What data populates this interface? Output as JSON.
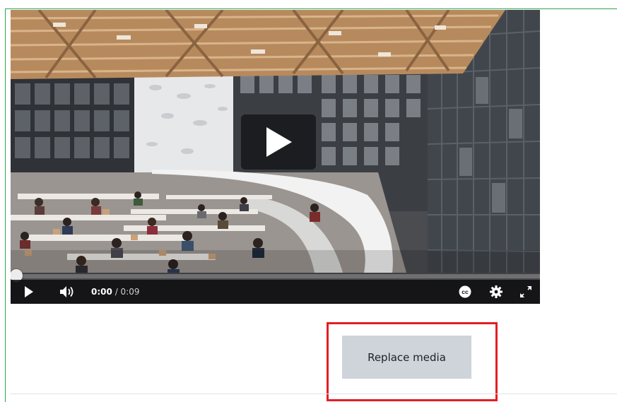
{
  "player": {
    "current_time": "0:00",
    "duration": "/ 0:09",
    "progress_fraction": 0.0,
    "play_icon": "play-icon",
    "volume_icon": "volume-icon",
    "captions_icon": "captions-icon",
    "settings_icon": "gear-icon",
    "fullscreen_icon": "fullscreen-icon"
  },
  "actions": {
    "replace_label": "Replace media"
  },
  "colors": {
    "frame_border": "#2ea44f",
    "highlight_border": "#e31e24",
    "button_bg": "#ced4da"
  }
}
